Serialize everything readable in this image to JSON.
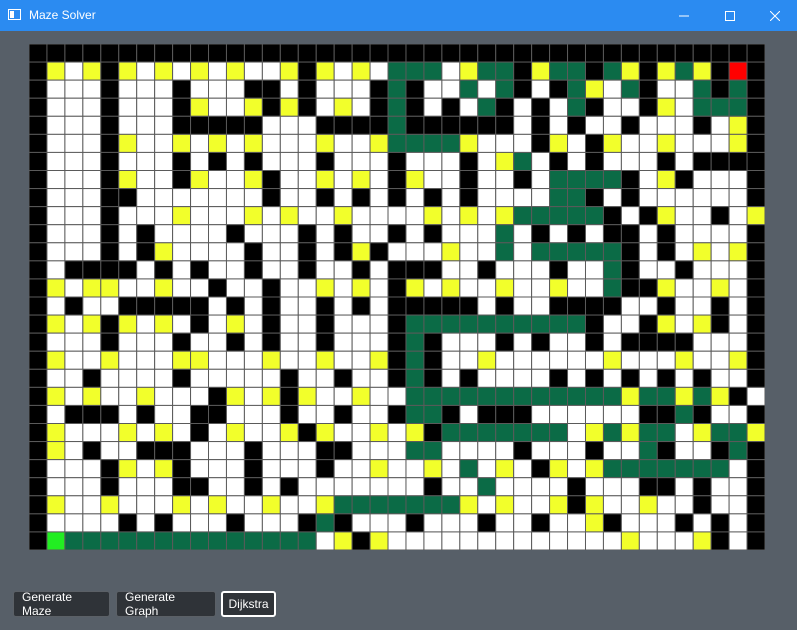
{
  "window": {
    "title": "Maze Solver",
    "controls": {
      "minimize": "—",
      "maximize": "☐",
      "close": "✕"
    }
  },
  "colors": {
    "wall": "#000000",
    "open": "#ffffff",
    "node": "#f2ff2b",
    "path": "#0b6b46",
    "start": "#22ee22",
    "end": "#ff0000",
    "grid_line": "#5a5a5a"
  },
  "maze": {
    "cols": 41,
    "rows": 28,
    "legend": "# wall, . open, Y graph node, P path, S start, E end",
    "grid": [
      "#########################################",
      "#Y.Y#Y.Y.Y.Y..Y#Y.Y.PPP.YPP#YPP#PY#YPY#E#",
      "#...#...#...##.#...#P#..P.P#.#PY.P#..P#P#",
      "#...#...#Y..Y#Y#.Y.#P#.#.P#.#.P#..#Y.PPP#",
      "#...#...#####...####P######.#.#..#...#.Y#",
      "#...#Y..Y.Y.Y...Y..YPPPPY...#Y.#Y..Y...Y#",
      "#...#...#.#.#...#...#...#.YP.#.#...#.####",
      "#...#Y..#Y..Y#..Y.Y.#Y..#..#.PPPP#.Y#...#",
      "#...##.......#..#.#.#.#.#....PP#.#......#",
      "#...#...Y...Y.Y..Y....Y.Y.YPPPPP#.#Y..#.Y#",
      "#...#.#....#...#.#..#.#...P.#.#.##.#....#",
      "#...#.#Y....#..#.#Y#...Y..P.PPPPP#.#.Y.Y#",
      "#.####.#.#..#..#..#.###..#...#..P#..#...#",
      "#Y.YY..Y..#..#..Y.Y.#Y.Y..Y..Y..P##Y..Y.#",
      "#.#..#####.#.#..#.#.#####.#..####..#..#.#",
      "#Y.Y#Y.Y.#.Y.#..#...#PPPPPPPPPP#..#Y.Y#.#",
      "#...#...#..#.#..#...#P#...#.#..#.####...#",
      "#Y..Y...YY...Y..Y..Y#P#..Y......Y...Y..Y#",
      "#..#....#.....#..#..#P#.#....#.#.#.#.#..#",
      "#Y.Y..Y...#Y.Y#Y..Y..PPPPPPPPPPPPYPPYPY#.#",
      "#.###.#..##...#..#..#PP#.###......##P#..#",
      "#Y...Y.Y.#.Y..Y#Y..Y.Y#PPPPPPP.YPYPP.YPPY#",
      "#Y.#..###...#...##...PP....#...#..P#..#P#",
      "#...#Y.Y#...#...#..Y..Y.P.Y.#Y.YPPPPPPP.#",
      "#...#...##..#.#.......#..P....#...##.#..#",
      "#Y..Y...Y.Y..Y..YPPPPPPPY.Y..Y#Y..Y..#..#",
      "#....#.#...#...#P#...#...#..#..Y#...#.#.#",
      "#SPPPPPPPPPPPPPP.Y#Y.............Y...Y#.#"
    ]
  },
  "buttons": {
    "generate_maze": "Generate Maze",
    "generate_graph": "Generate Graph",
    "dijkstra": "Dijkstra"
  }
}
